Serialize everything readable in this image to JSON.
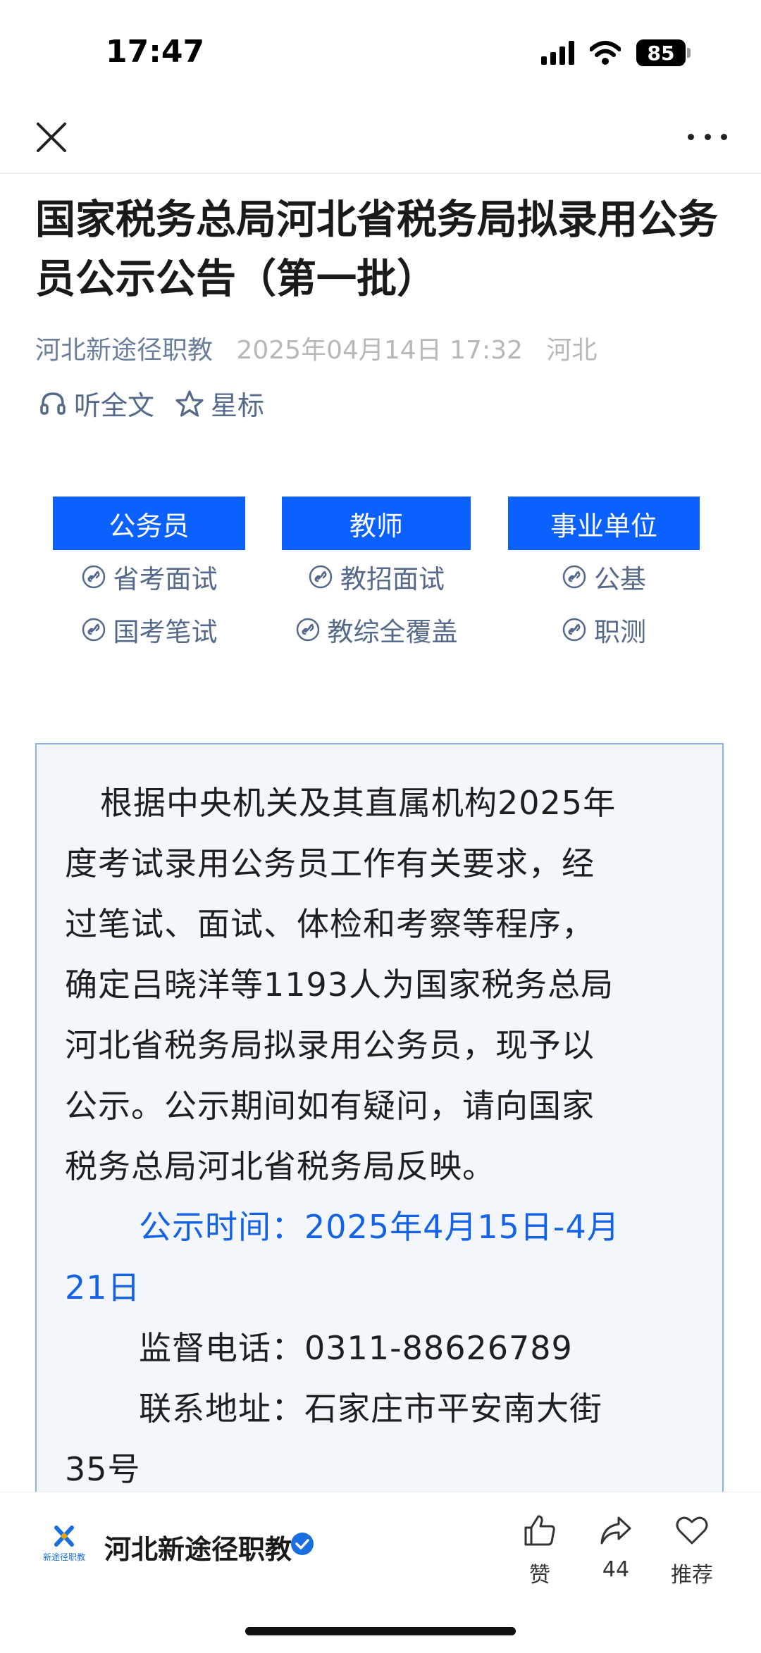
{
  "status_bar": {
    "time": "17:47",
    "battery": "85"
  },
  "nav": {
    "close_icon": "close-icon",
    "more_icon": "more-icon"
  },
  "article": {
    "title": "国家税务总局河北省税务局拟录用公务员公示公告（第一批）",
    "author": "河北新途径职教",
    "date": "2025年04月14日 17:32",
    "location": "河北",
    "listen_label": "听全文",
    "star_label": "星标"
  },
  "categories": [
    {
      "header": "公务员",
      "links": [
        "省考面试",
        "国考笔试"
      ]
    },
    {
      "header": "教师",
      "links": [
        "教招面试",
        "教综全覆盖"
      ]
    },
    {
      "header": "事业单位",
      "links": [
        "公基",
        "职测"
      ]
    }
  ],
  "notice": {
    "lines": [
      "根据中央机关及其直属机构2025年",
      "度考试录用公务员工作有关要求，经",
      "过笔试、面试、体检和考察等程序，",
      "确定吕晓洋等1193人为国家税务总局",
      "河北省税务局拟录用公务员，现予以",
      "公示。公示期间如有疑问，请向国家",
      "税务总局河北省税务局反映。"
    ],
    "time_line_1": "公示时间：2025年4月15日-4月",
    "time_line_2": "21日",
    "phone_line": "监督电话：0311-88626789",
    "address_line_1": "联系地址：石家庄市平安南大街",
    "address_line_2": "35号"
  },
  "bottom_bar": {
    "account_name": "河北新途径职教",
    "logo_text": "新途径职教",
    "like_label": "赞",
    "share_count": "44",
    "recommend_label": "推荐"
  },
  "colors": {
    "accent_blue": "#0b61ff",
    "link_blue": "#1462e6",
    "meta_blue": "#6b7f9d"
  }
}
